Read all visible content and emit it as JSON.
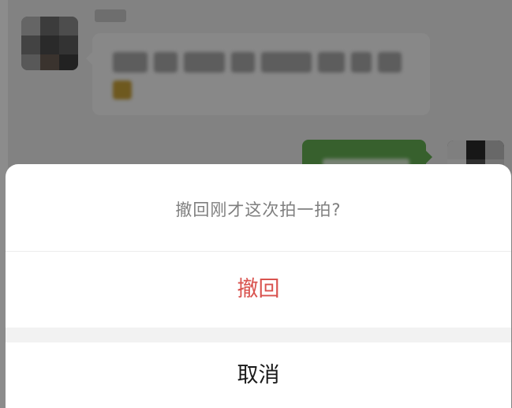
{
  "dialog": {
    "title": "撤回刚才这次拍一拍?",
    "confirm_label": "撤回",
    "cancel_label": "取消"
  },
  "colors": {
    "confirm_text": "#d9534f",
    "cancel_text": "#1a1a1a",
    "title_text": "#7f7f7f",
    "sent_bubble": "#64b052"
  }
}
